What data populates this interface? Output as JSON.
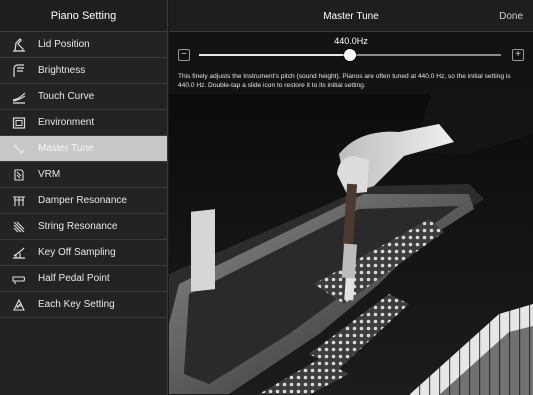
{
  "sidebar": {
    "title": "Piano Setting",
    "items": [
      {
        "label": "Lid Position",
        "icon": "lid-icon"
      },
      {
        "label": "Brightness",
        "icon": "brightness-icon"
      },
      {
        "label": "Touch Curve",
        "icon": "touch-curve-icon"
      },
      {
        "label": "Environment",
        "icon": "environment-icon"
      },
      {
        "label": "Master Tune",
        "icon": "tuning-hammer-icon",
        "selected": true
      },
      {
        "label": "VRM",
        "icon": "vrm-icon"
      },
      {
        "label": "Damper Resonance",
        "icon": "damper-resonance-icon"
      },
      {
        "label": "String Resonance",
        "icon": "string-resonance-icon"
      },
      {
        "label": "Key Off Sampling",
        "icon": "key-off-sampling-icon"
      },
      {
        "label": "Half Pedal Point",
        "icon": "half-pedal-icon"
      },
      {
        "label": "Each Key Setting",
        "icon": "each-key-icon"
      }
    ]
  },
  "header": {
    "title": "Master Tune",
    "done_label": "Done"
  },
  "tune": {
    "value": "440.0Hz",
    "minus_label": "−",
    "plus_label": "+",
    "slider_fraction": 0.5,
    "description": "This finely adjusts the Instrument's pitch (sound height). Pianos are often tuned at 440.0 Hz, so the initial setting is 440.0 Hz. Double-tap a slide icon to restore it to its initial setting."
  }
}
